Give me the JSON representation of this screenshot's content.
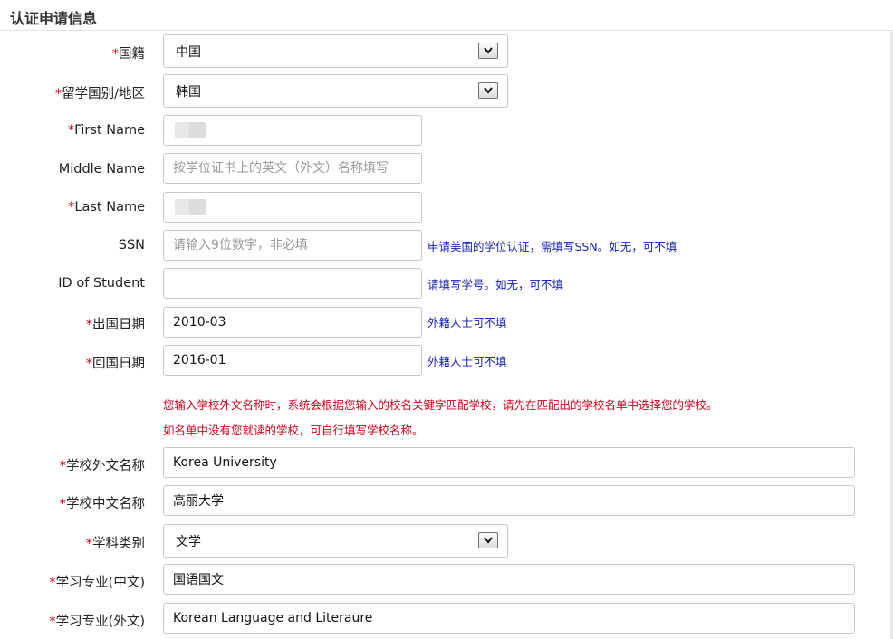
{
  "section": {
    "title": "认证申请信息"
  },
  "required_mark": "*",
  "fields": {
    "nationality": {
      "label": "国籍",
      "value": "中国"
    },
    "study_country": {
      "label": "留学国别/地区",
      "value": "韩国"
    },
    "first_name": {
      "label": "First Name",
      "value": ""
    },
    "middle_name": {
      "label": "Middle Name",
      "placeholder": "按学位证书上的英文（外文）名称填写"
    },
    "last_name": {
      "label": "Last Name",
      "value": ""
    },
    "ssn": {
      "label": "SSN",
      "placeholder": "请输入9位数字，非必填",
      "hint": "申请美国的学位认证，需填写SSN。如无，可不填"
    },
    "student_id": {
      "label": "ID of Student",
      "value": "",
      "hint": "请填写学号。如无，可不填"
    },
    "departure_date": {
      "label": "出国日期",
      "value": "2010-03",
      "hint": "外籍人士可不填"
    },
    "return_date": {
      "label": "回国日期",
      "value": "2016-01",
      "hint": "外籍人士可不填"
    },
    "school_foreign_name": {
      "label": "学校外文名称",
      "value": "Korea University"
    },
    "school_chinese_name": {
      "label": "学校中文名称",
      "value": "高丽大学"
    },
    "subject_category": {
      "label": "学科类别",
      "value": "文学"
    },
    "major_chinese": {
      "label": "学习专业(中文)",
      "value": "国语国文"
    },
    "major_foreign": {
      "label": "学习专业(外文)",
      "value": "Korean Language and Literaure"
    }
  },
  "notice": {
    "line1": "您输入学校外文名称时，系统会根据您输入的校名关键字匹配学校，请先在匹配出的学校名单中选择您的学校。",
    "line2": "如名单中没有您就读的学校，可自行填写学校名称。"
  }
}
